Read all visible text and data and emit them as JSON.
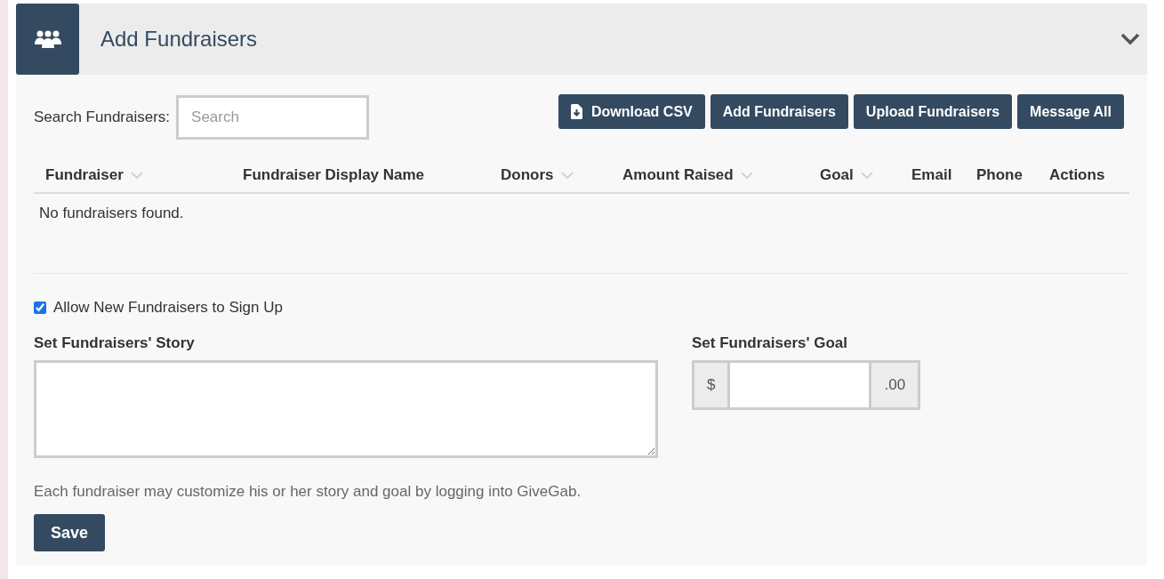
{
  "panel": {
    "title": "Add Fundraisers",
    "expanded": true
  },
  "search": {
    "label": "Search Fundraisers:",
    "placeholder": "Search"
  },
  "buttons": [
    {
      "label": "Download CSV",
      "kind": "download"
    },
    {
      "label": "Add Fundraisers",
      "kind": "plain"
    },
    {
      "label": "Upload Fundraisers",
      "kind": "plain"
    },
    {
      "label": "Message All",
      "kind": "plain"
    }
  ],
  "table": {
    "columns": [
      {
        "label": "Fundraiser",
        "sortable": true
      },
      {
        "label": "Fundraiser Display Name",
        "sortable": false
      },
      {
        "label": "Donors",
        "sortable": true
      },
      {
        "label": "Amount Raised",
        "sortable": true
      },
      {
        "label": "Goal",
        "sortable": true
      },
      {
        "label": "Email",
        "sortable": false
      },
      {
        "label": "Phone",
        "sortable": false
      },
      {
        "label": "Actions",
        "sortable": false
      }
    ],
    "empty_message": "No fundraisers found."
  },
  "allow_signup": {
    "label": "Allow New Fundraisers to Sign Up",
    "checked": true
  },
  "story": {
    "label": "Set Fundraisers' Story"
  },
  "goal": {
    "label": "Set Fundraisers' Goal",
    "prefix": "$",
    "suffix": ".00"
  },
  "help_text": "Each fundraiser may customize his or her story and goal by logging into GiveGab.",
  "save_button": "Save"
}
